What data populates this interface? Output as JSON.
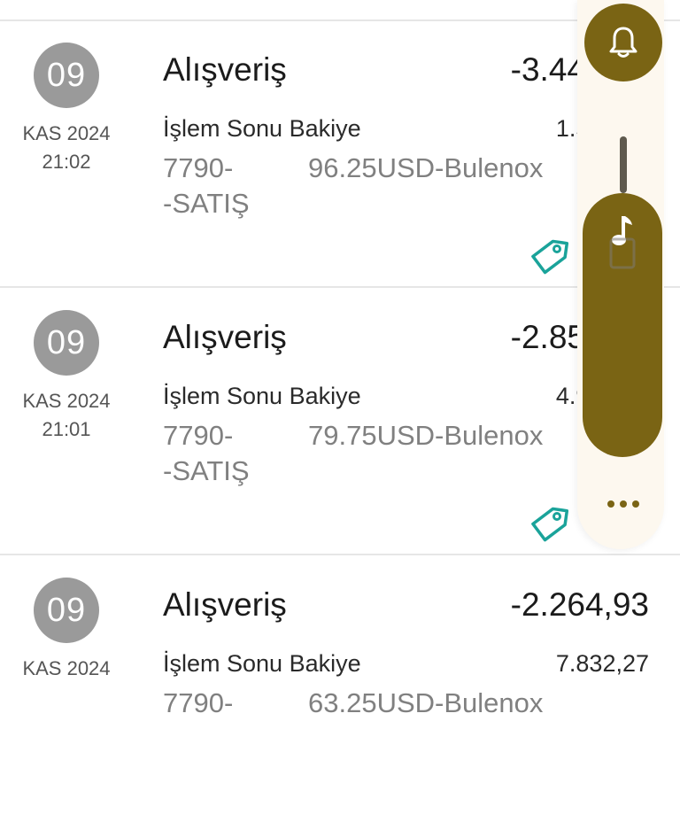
{
  "transactions": [
    {
      "day": "09",
      "month_year": "KAS 2024",
      "time": "21:02",
      "title": "Alışveriş",
      "amount": "-3.446,64",
      "balance_label": "İşlem Sonu Bakiye",
      "balance": "1.529,84",
      "desc_a": "7790-",
      "desc_b": "96.25USD-Bulenox",
      "desc_c": "-SATIŞ"
    },
    {
      "day": "09",
      "month_year": "KAS 2024",
      "time": "21:01",
      "title": "Alışveriş",
      "amount": "-2.855,79",
      "balance_label": "İşlem Sonu Bakiye",
      "balance": "4.976,48",
      "desc_a": "7790-",
      "desc_b": "79.75USD-Bulenox",
      "desc_c": "-SATIŞ"
    },
    {
      "day": "09",
      "month_year": "KAS 2024",
      "time": "",
      "title": "Alışveriş",
      "amount": "-2.264,93",
      "balance_label": "İşlem Sonu Bakiye",
      "balance": "7.832,27",
      "desc_a": "7790-",
      "desc_b": "63.25USD-Bulenox",
      "desc_c": ""
    }
  ],
  "icons": {
    "tag": "tag-icon",
    "document": "document-icon",
    "bell": "bell-icon",
    "music": "music-note-icon",
    "more": "more-horizontal-icon"
  },
  "colors": {
    "accent": "#7a6414",
    "tag": "#1aa39a",
    "day_circle": "#9a9a9a",
    "panel_bg": "#fdf8ef"
  }
}
